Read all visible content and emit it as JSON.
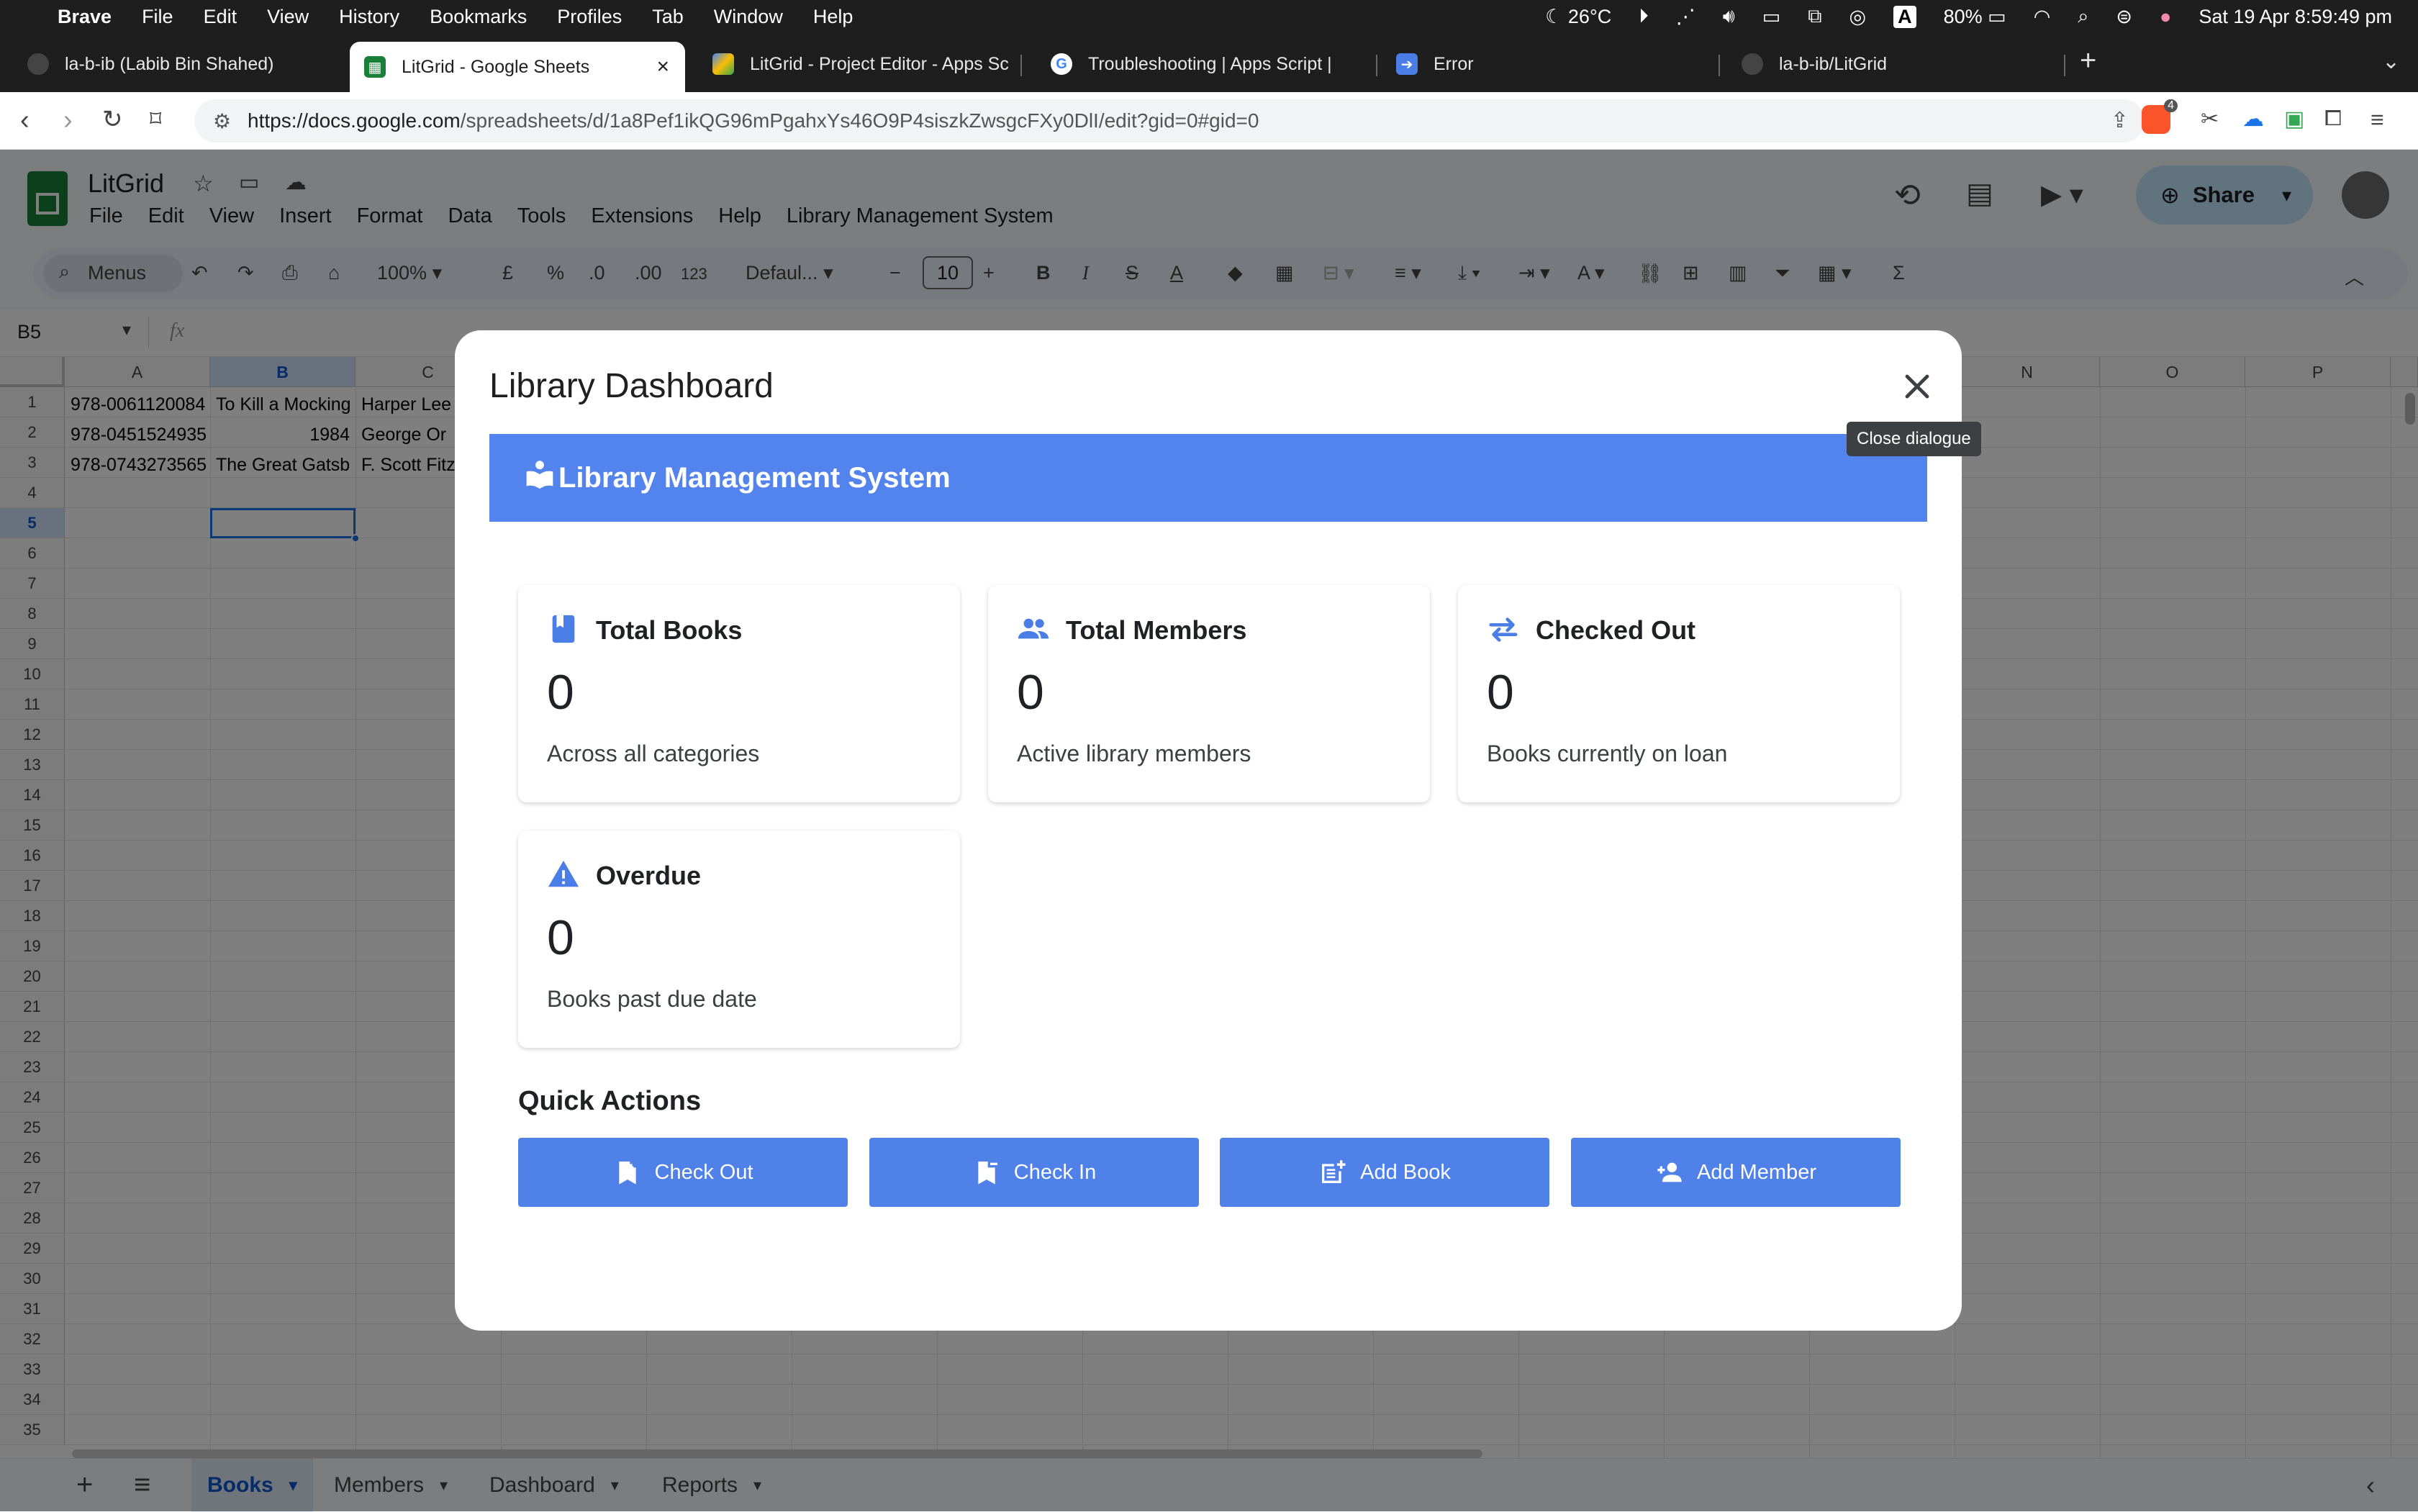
{
  "menubar": {
    "app": "Brave",
    "items": [
      "File",
      "Edit",
      "View",
      "History",
      "Bookmarks",
      "Profiles",
      "Tab",
      "Window",
      "Help"
    ],
    "weather": "26°C",
    "battery": "80%",
    "datetime": "Sat 19 Apr  8:59:49 pm"
  },
  "browser_tabs": [
    {
      "title": "la-b-ib (Labib Bin Shahed)"
    },
    {
      "title": "LitGrid - Google Sheets"
    },
    {
      "title": "LitGrid - Project Editor - Apps Sc"
    },
    {
      "title": "Troubleshooting  |  Apps Script  |"
    },
    {
      "title": "Error"
    },
    {
      "title": "la-b-ib/LitGrid"
    }
  ],
  "address": {
    "url_host": "https://docs.google.com",
    "url_path": "/spreadsheets/d/1a8Pef1ikQG96mPgahxYs46O9P4siszkZwsgcFXy0DlI/edit?gid=0#gid=0",
    "shields_count": "4"
  },
  "sheets": {
    "title": "LitGrid",
    "menus": [
      "File",
      "Edit",
      "View",
      "Insert",
      "Format",
      "Data",
      "Tools",
      "Extensions",
      "Help",
      "Library Management System"
    ],
    "share_label": "Share",
    "toolbar": {
      "search": "Menus",
      "zoom": "100%",
      "currency": "£",
      "percent": "%",
      "dec_minus": ".0",
      "dec_plus": ".00",
      "format123": "123",
      "font": "Defaul...",
      "font_size": "10"
    },
    "name_box": "B5",
    "fx": "fx",
    "columns": [
      "A",
      "B",
      "C",
      "N",
      "O",
      "P"
    ],
    "rows": [
      "1",
      "2",
      "3",
      "4",
      "5",
      "6",
      "7",
      "8",
      "9",
      "10",
      "11",
      "12",
      "13",
      "14",
      "15",
      "16",
      "17",
      "18",
      "19",
      "20",
      "21",
      "22",
      "23",
      "24",
      "25",
      "26",
      "27",
      "28",
      "29",
      "30",
      "31",
      "32",
      "33",
      "34",
      "35"
    ],
    "cells": [
      [
        "978-0061120084",
        "To Kill a Mocking",
        "Harper Lee"
      ],
      [
        "978-0451524935",
        "1984",
        "George Or"
      ],
      [
        "978-0743273565",
        "The Great Gatsb",
        "F. Scott Fitz"
      ]
    ],
    "sheet_tabs": [
      "Books",
      "Members",
      "Dashboard",
      "Reports"
    ],
    "active_sheet": "Books"
  },
  "dialog": {
    "title": "Library Dashboard",
    "close_tooltip": "Close dialogue",
    "banner": "Library Management System",
    "cards": [
      {
        "title": "Total Books",
        "value": "0",
        "desc": "Across all categories",
        "icon": "book-icon"
      },
      {
        "title": "Total Members",
        "value": "0",
        "desc": "Active library members",
        "icon": "people-icon"
      },
      {
        "title": "Checked Out",
        "value": "0",
        "desc": "Books currently on loan",
        "icon": "swap-arrows-icon"
      },
      {
        "title": "Overdue",
        "value": "0",
        "desc": "Books past due date",
        "icon": "warning-icon"
      }
    ],
    "quick_actions_title": "Quick Actions",
    "actions": [
      {
        "label": "Check Out",
        "icon": "bookmark-add-icon"
      },
      {
        "label": "Check In",
        "icon": "bookmark-remove-icon"
      },
      {
        "label": "Add Book",
        "icon": "post-add-icon"
      },
      {
        "label": "Add Member",
        "icon": "person-add-icon"
      }
    ]
  },
  "colors": {
    "banner": "#5383ec",
    "button": "#4f81e8",
    "card_icon": "#4a7ee6",
    "sheets_green": "#188038",
    "selection": "#1a73e8"
  }
}
